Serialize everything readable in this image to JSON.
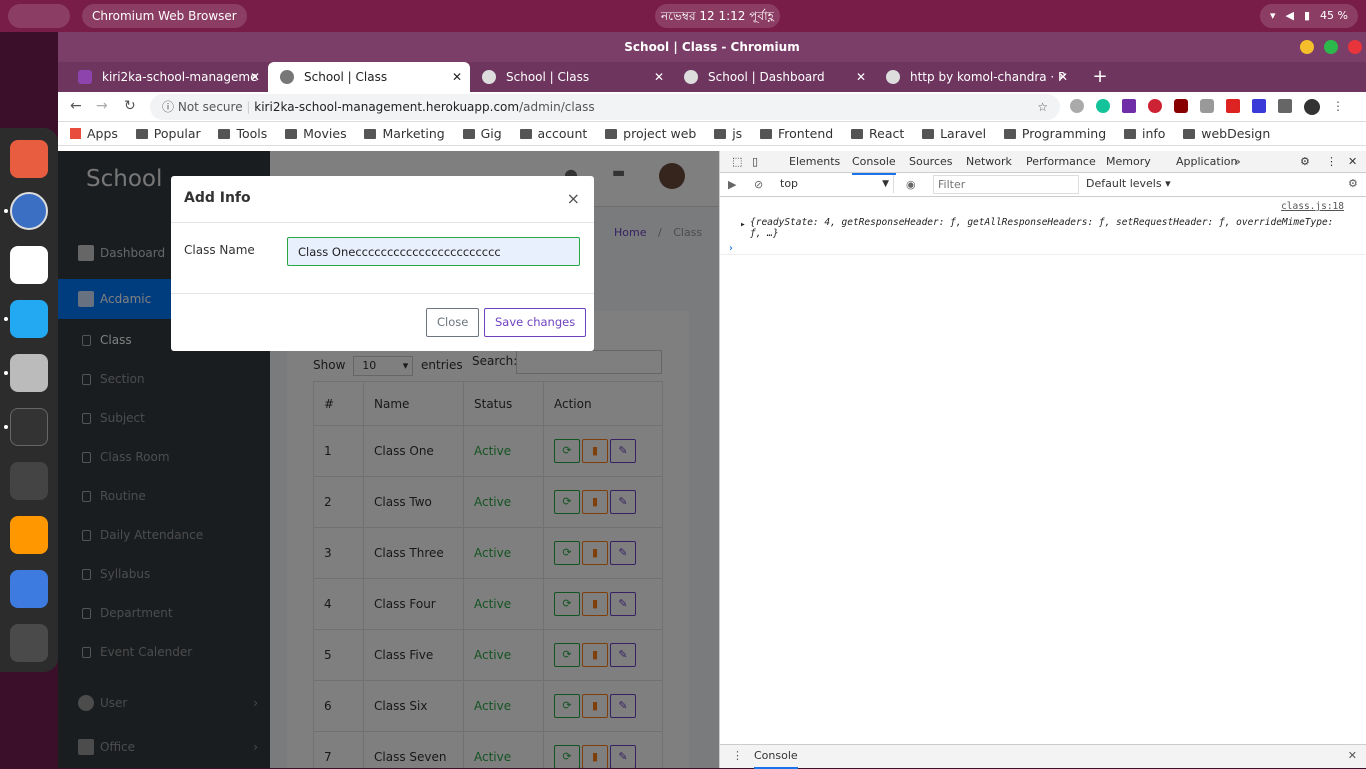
{
  "os": {
    "app_label": "Chromium Web Browser",
    "clock": "নভেম্বর 12   1:12 পূর্বাহ্ণ",
    "battery": "45 %"
  },
  "window": {
    "title": "School | Class - Chromium"
  },
  "tabs": [
    {
      "label": "kiri2ka-school-manageme",
      "fav_color": "#8e44ad"
    },
    {
      "label": "School | Class",
      "fav_color": "#555555"
    },
    {
      "label": "School | Class",
      "fav_color": "#dddddd"
    },
    {
      "label": "School | Dashboard",
      "fav_color": "#dddddd"
    },
    {
      "label": "http by komol-chandra · P",
      "fav_color": "#dddddd"
    }
  ],
  "address": {
    "security": "Not secure",
    "host": "kiri2ka-school-management.herokuapp.com",
    "path": "/admin/class"
  },
  "bookmarks": [
    "Apps",
    "Popular",
    "Tools",
    "Movies",
    "Marketing",
    "Gig",
    "account",
    "project web",
    "js",
    "Frontend",
    "React",
    "Laravel",
    "Programming",
    "info",
    "webDesign"
  ],
  "sidebar": {
    "brand": "School",
    "items": [
      "Dashboard",
      "Acdamic",
      "Class",
      "Section",
      "Subject",
      "Class Room",
      "Routine",
      "Daily Attendance",
      "Syllabus",
      "Department",
      "Event Calender",
      "User",
      "Office"
    ]
  },
  "breadcrumb": {
    "home": "Home",
    "current": "Class"
  },
  "table_controls": {
    "show": "Show",
    "entries_value": "10",
    "entries": "entries",
    "search": "Search:"
  },
  "table": {
    "headers": [
      "#",
      "Name",
      "Status",
      "Action"
    ],
    "rows": [
      {
        "n": "1",
        "name": "Class One",
        "status": "Active"
      },
      {
        "n": "2",
        "name": "Class Two",
        "status": "Active"
      },
      {
        "n": "3",
        "name": "Class Three",
        "status": "Active"
      },
      {
        "n": "4",
        "name": "Class Four",
        "status": "Active"
      },
      {
        "n": "5",
        "name": "Class Five",
        "status": "Active"
      },
      {
        "n": "6",
        "name": "Class Six",
        "status": "Active"
      },
      {
        "n": "7",
        "name": "Class Seven",
        "status": "Active"
      }
    ]
  },
  "modal": {
    "title": "Add Info",
    "close_x": "×",
    "field_label": "Class Name",
    "field_value": "Class Oneccccccccccccccccccccccc",
    "close_btn": "Close",
    "save_btn": "Save changes"
  },
  "devtools": {
    "tabs": [
      "Elements",
      "Console",
      "Sources",
      "Network",
      "Performance",
      "Memory",
      "Application",
      "»"
    ],
    "context": "top",
    "filter_placeholder": "Filter",
    "levels": "Default levels ▾",
    "log_source": "class.js:18",
    "log_line1": "{readyState: 4, getResponseHeader: ƒ, getAllResponseHeaders: ƒ, setRequestHeader: ƒ, overrideMimeType:",
    "log_line2": "ƒ, …}",
    "drawer": "Console"
  },
  "colors": {
    "accent": "#6f42c1",
    "active_nav": "#007bff",
    "success": "#28a745"
  }
}
